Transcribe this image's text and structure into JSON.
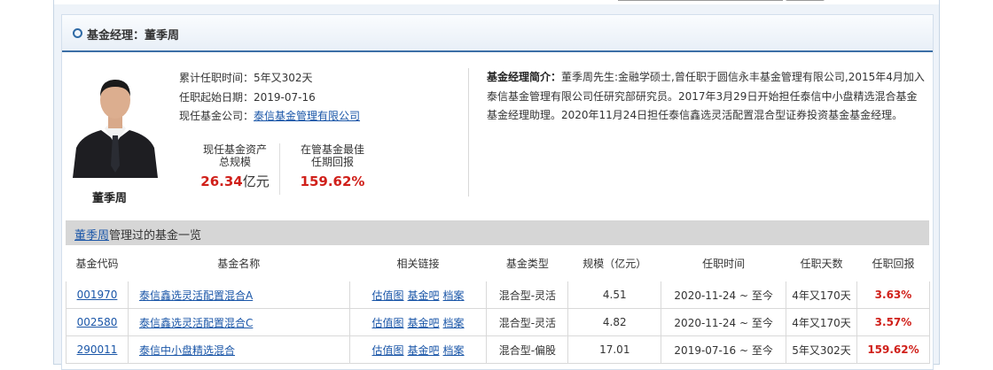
{
  "panel": {
    "title": "基金经理：董季周"
  },
  "manager": {
    "name": "董季周",
    "tenure_label": "累计任职时间：",
    "tenure": "5年又302天",
    "start_label": "任职起始日期：",
    "start_date": "2019-07-16",
    "company_label": "现任基金公司：",
    "company": "泰信基金管理有限公司"
  },
  "stats": {
    "assets_label_1": "现任基金资产",
    "assets_label_2": "总规模",
    "assets_value": "26.34",
    "assets_unit": "亿元",
    "return_label_1": "在管基金最佳",
    "return_label_2": "任期回报",
    "return_value": "159.62%"
  },
  "intro": {
    "label": "基金经理简介：",
    "text": "董季周先生:金融学硕士,曾任职于圆信永丰基金管理有限公司,2015年4月加入泰信基金管理有限公司任研究部研究员。2017年3月29日开始担任泰信中小盘精选混合基金基金经理助理。2020年11月24日担任泰信鑫选灵活配置混合型证券投资基金基金经理。"
  },
  "section": {
    "manager_link": "董季周",
    "title_suffix": "管理过的基金一览"
  },
  "table": {
    "headers": [
      "基金代码",
      "基金名称",
      "相关链接",
      "基金类型",
      "规模（亿元）",
      "任职时间",
      "任职天数",
      "任职回报"
    ],
    "link_labels": [
      "估值图",
      "基金吧",
      "档案"
    ],
    "rows": [
      {
        "code": "001970",
        "name": "泰信鑫选灵活配置混合A",
        "type": "混合型-灵活",
        "size": "4.51",
        "period": "2020-11-24 ~ 至今",
        "days": "4年又170天",
        "ret": "3.63%"
      },
      {
        "code": "002580",
        "name": "泰信鑫选灵活配置混合C",
        "type": "混合型-灵活",
        "size": "4.82",
        "period": "2020-11-24 ~ 至今",
        "days": "4年又170天",
        "ret": "3.57%"
      },
      {
        "code": "290011",
        "name": "泰信中小盘精选混合",
        "type": "混合型-偏股",
        "size": "17.01",
        "period": "2019-07-16 ~ 至今",
        "days": "5年又302天",
        "ret": "159.62%"
      }
    ]
  }
}
